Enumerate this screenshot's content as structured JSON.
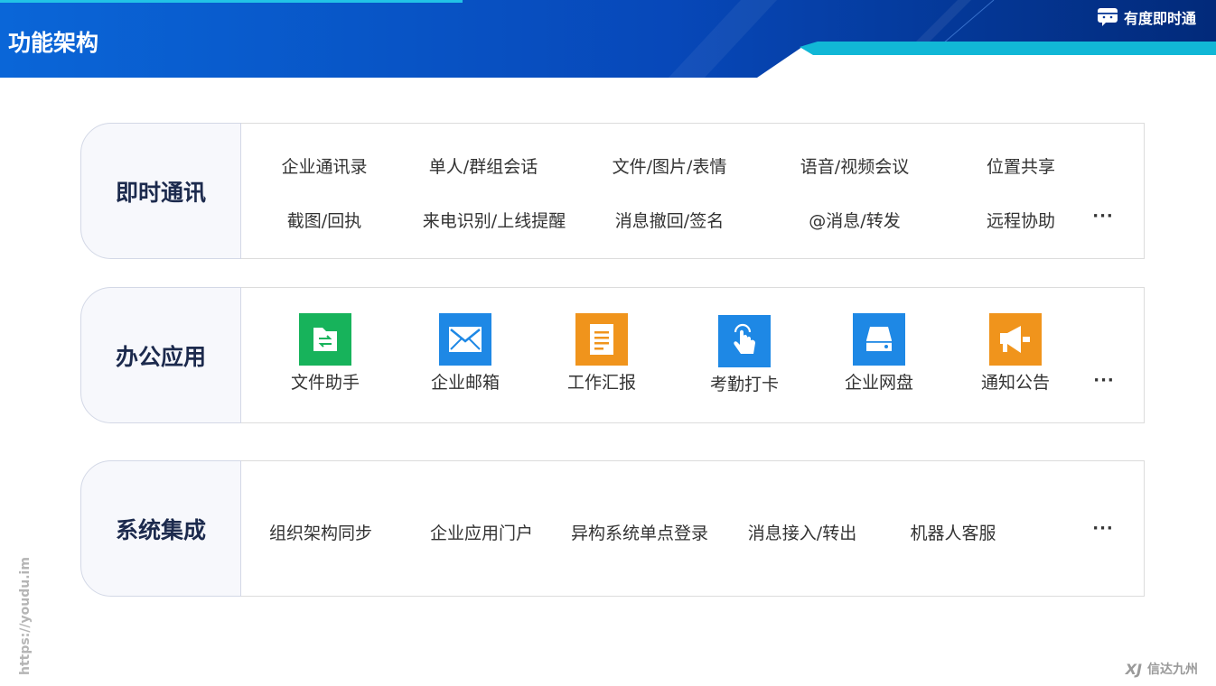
{
  "header": {
    "title": "功能架构",
    "brand": "有度即时通"
  },
  "sections": [
    {
      "label": "即时通讯",
      "row1": [
        "企业通讯录",
        "单人/群组会话",
        "文件/图片/表情",
        "语音/视频会议",
        "位置共享"
      ],
      "row2": [
        "截图/回执",
        "来电识别/上线提醒",
        "消息撤回/签名",
        "@消息/转发",
        "远程协助"
      ],
      "more": "···"
    },
    {
      "label": "办公应用",
      "apps": [
        {
          "name": "文件助手",
          "icon": "file-transfer-icon",
          "color": "#17b35b"
        },
        {
          "name": "企业邮箱",
          "icon": "mail-icon",
          "color": "#1e88e5"
        },
        {
          "name": "工作汇报",
          "icon": "report-icon",
          "color": "#f0941c"
        },
        {
          "name": "考勤打卡",
          "icon": "tap-hand-icon",
          "color": "#1e88e5"
        },
        {
          "name": "企业网盘",
          "icon": "disk-icon",
          "color": "#1e88e5"
        },
        {
          "name": "通知公告",
          "icon": "megaphone-icon",
          "color": "#f0941c"
        }
      ],
      "more": "···"
    },
    {
      "label": "系统集成",
      "items": [
        "组织架构同步",
        "企业应用门户",
        "异构系统单点登录",
        "消息接入/转出",
        "机器人客服"
      ],
      "more": "···"
    }
  ],
  "footer": {
    "url": "https://youdu.im",
    "company": "信达九州",
    "mark": "XJ"
  }
}
